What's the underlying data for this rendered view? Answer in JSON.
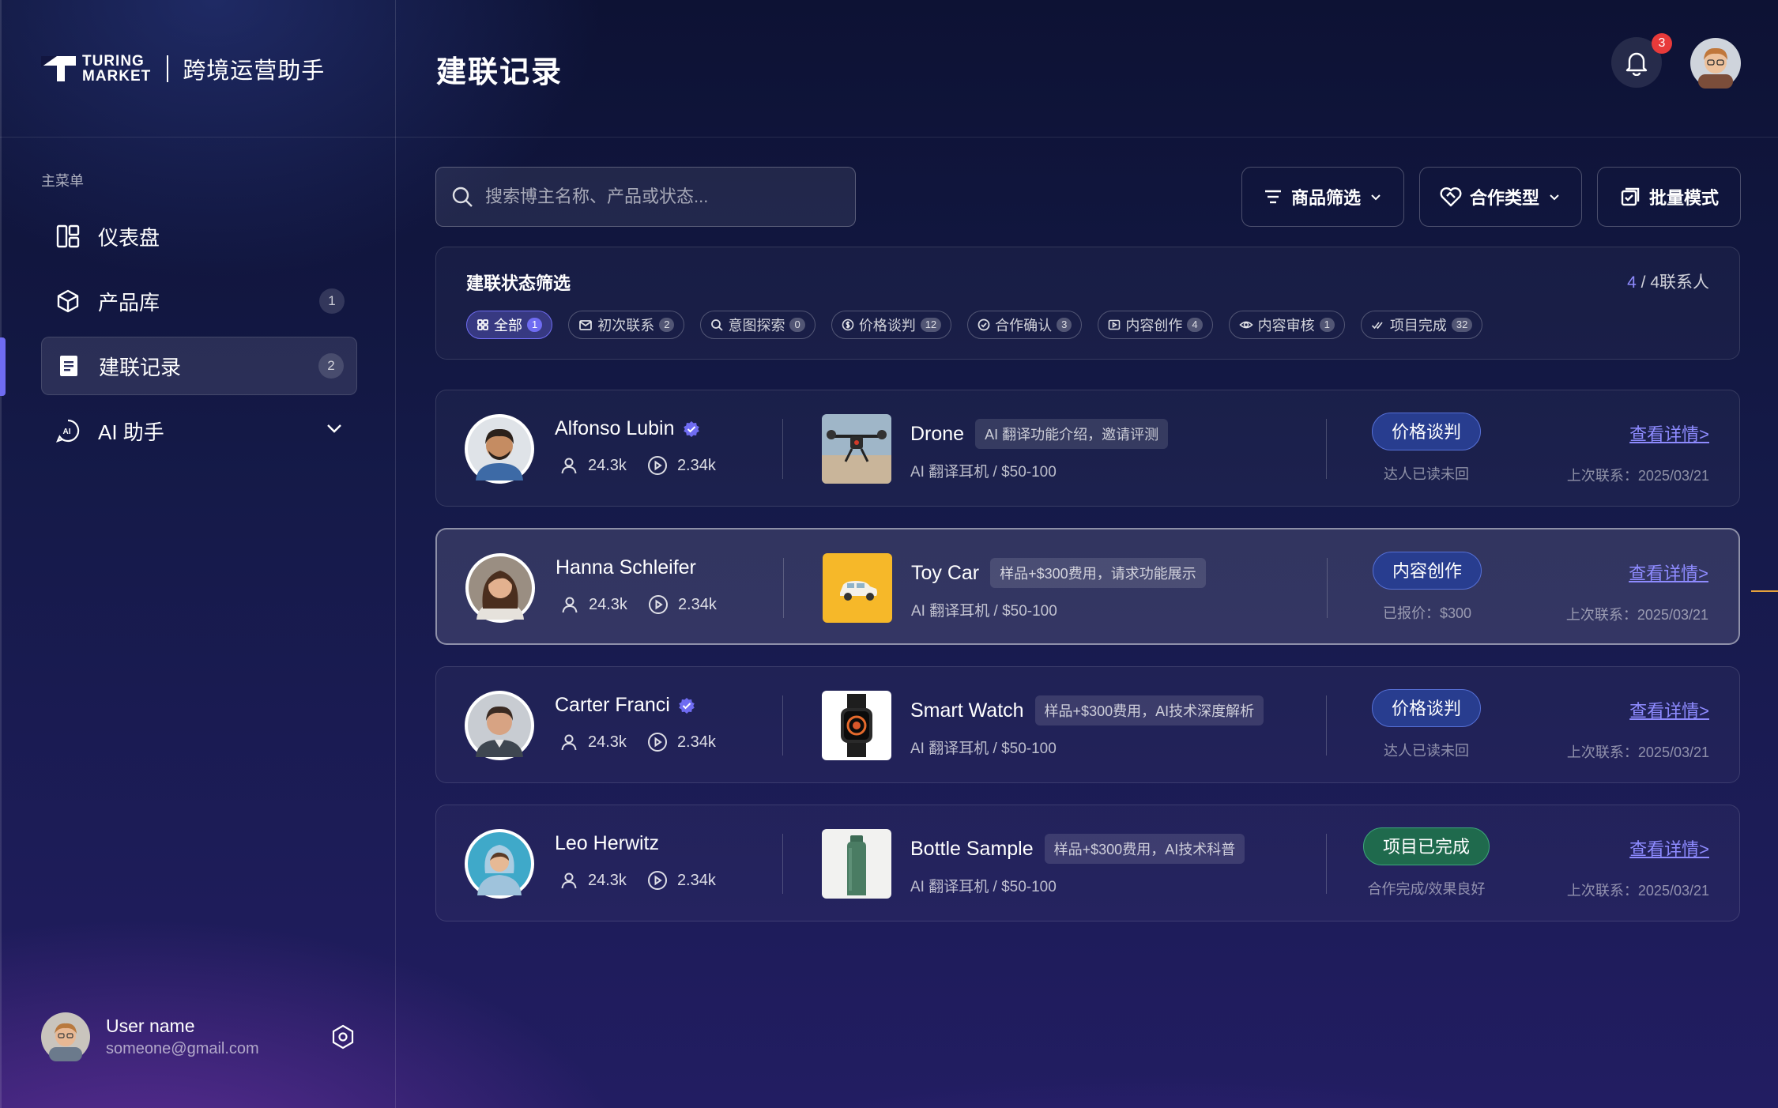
{
  "brand": {
    "logo_line1": "TURING",
    "logo_line2": "MARKET",
    "app_name": "跨境运营助手"
  },
  "sidebar": {
    "menu_title": "主菜单",
    "items": [
      {
        "label": "仪表盘",
        "icon": "dashboard-icon",
        "badge": ""
      },
      {
        "label": "产品库",
        "icon": "cube-icon",
        "badge": "1"
      },
      {
        "label": "建联记录",
        "icon": "document-icon",
        "badge": "2",
        "active": true
      },
      {
        "label": "AI 助手",
        "icon": "ai-chat-icon",
        "badge": ""
      }
    ],
    "user": {
      "name": "User name",
      "email": "someone@gmail.com"
    }
  },
  "header": {
    "title": "建联记录",
    "notifications": "3"
  },
  "toolbar": {
    "search_placeholder": "搜索博主名称、产品或状态...",
    "product_filter": "商品筛选",
    "coop_type": "合作类型",
    "batch_mode": "批量模式"
  },
  "status_filter": {
    "title": "建联状态筛选",
    "count_current": "4",
    "count_total": " / 4联系人",
    "chips": [
      {
        "label": "全部",
        "count": "1",
        "icon": "grid-icon",
        "active": true
      },
      {
        "label": "初次联系",
        "count": "2",
        "icon": "mail-icon"
      },
      {
        "label": "意图探索",
        "count": "0",
        "icon": "search-icon"
      },
      {
        "label": "价格谈判",
        "count": "12",
        "icon": "dollar-icon"
      },
      {
        "label": "合作确认",
        "count": "3",
        "icon": "check-circle-icon"
      },
      {
        "label": "内容创作",
        "count": "4",
        "icon": "play-square-icon"
      },
      {
        "label": "内容审核",
        "count": "1",
        "icon": "eye-icon"
      },
      {
        "label": "项目完成",
        "count": "32",
        "icon": "double-check-icon"
      }
    ]
  },
  "records": [
    {
      "name": "Alfonso Lubin",
      "verified": true,
      "followers": "24.3k",
      "views": "2.34k",
      "product": "Drone",
      "tag": "AI 翻译功能介绍，邀请评测",
      "sub": "AI 翻译耳机 / $50-100",
      "status": "价格谈判",
      "status_color": "blue",
      "note": "达人已读未回",
      "detail": "查看详情>",
      "last_contact": "上次联系：2025/03/21"
    },
    {
      "name": "Hanna Schleifer",
      "verified": false,
      "followers": "24.3k",
      "views": "2.34k",
      "product": "Toy Car",
      "tag": "样品+$300费用，请求功能展示",
      "sub": "AI 翻译耳机 / $50-100",
      "status": "内容创作",
      "status_color": "blue",
      "note": "已报价：$300",
      "detail": "查看详情>",
      "last_contact": "上次联系：2025/03/21"
    },
    {
      "name": "Carter Franci",
      "verified": true,
      "followers": "24.3k",
      "views": "2.34k",
      "product": "Smart Watch",
      "tag": "样品+$300费用，AI技术深度解析",
      "sub": "AI 翻译耳机 / $50-100",
      "status": "价格谈判",
      "status_color": "blue",
      "note": "达人已读未回",
      "detail": "查看详情>",
      "last_contact": "上次联系：2025/03/21"
    },
    {
      "name": "Leo Herwitz",
      "verified": false,
      "followers": "24.3k",
      "views": "2.34k",
      "product": "Bottle Sample",
      "tag": "样品+$300费用，AI技术科普",
      "sub": "AI 翻译耳机 / $50-100",
      "status": "项目已完成",
      "status_color": "green",
      "note": "合作完成/效果良好",
      "detail": "查看详情>",
      "last_contact": "上次联系：2025/03/21"
    }
  ],
  "colors": {
    "accent": "#6f6cf2",
    "link": "#8e8bff",
    "badge_red": "#e83a3a",
    "pill_blue": "#283d8f",
    "pill_green": "#1f6a4d"
  }
}
